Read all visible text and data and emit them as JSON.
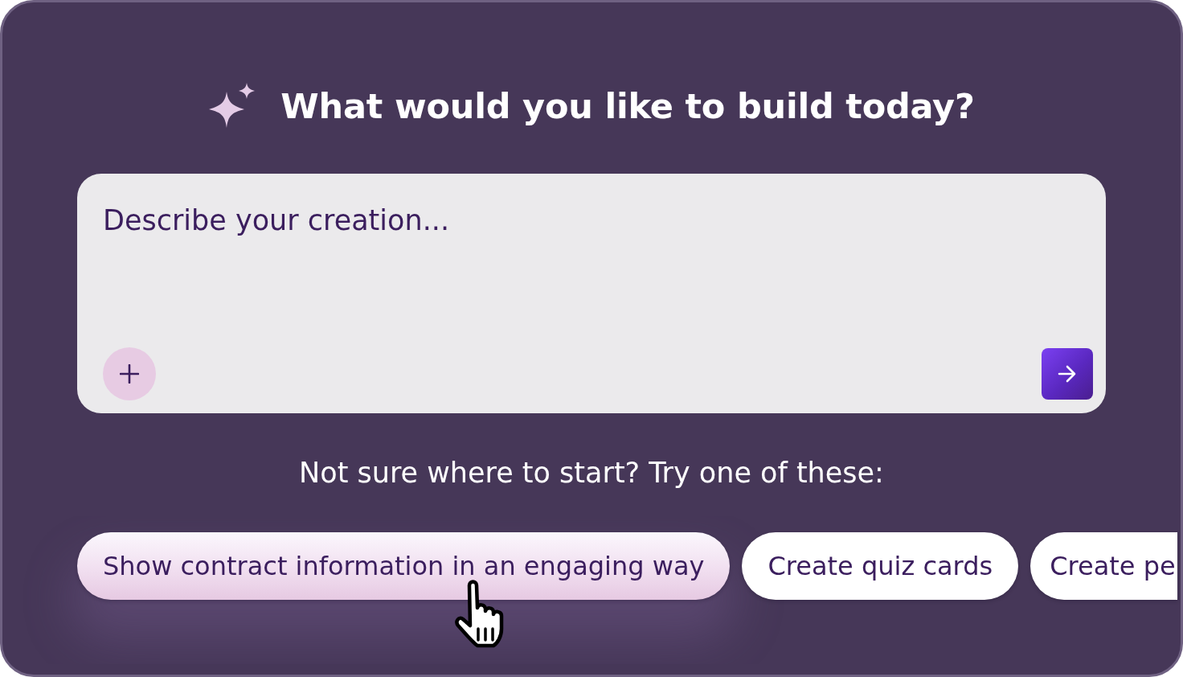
{
  "header": {
    "title": "What would you like to build today?"
  },
  "prompt": {
    "placeholder": "Describe your creation..."
  },
  "suggestions_intro": "Not sure where to start? Try one of these:",
  "suggestions": [
    {
      "label": "Show contract information in an engaging way",
      "hovered": true
    },
    {
      "label": "Create quiz cards",
      "hovered": false
    },
    {
      "label": "Create pe",
      "hovered": false
    }
  ]
}
